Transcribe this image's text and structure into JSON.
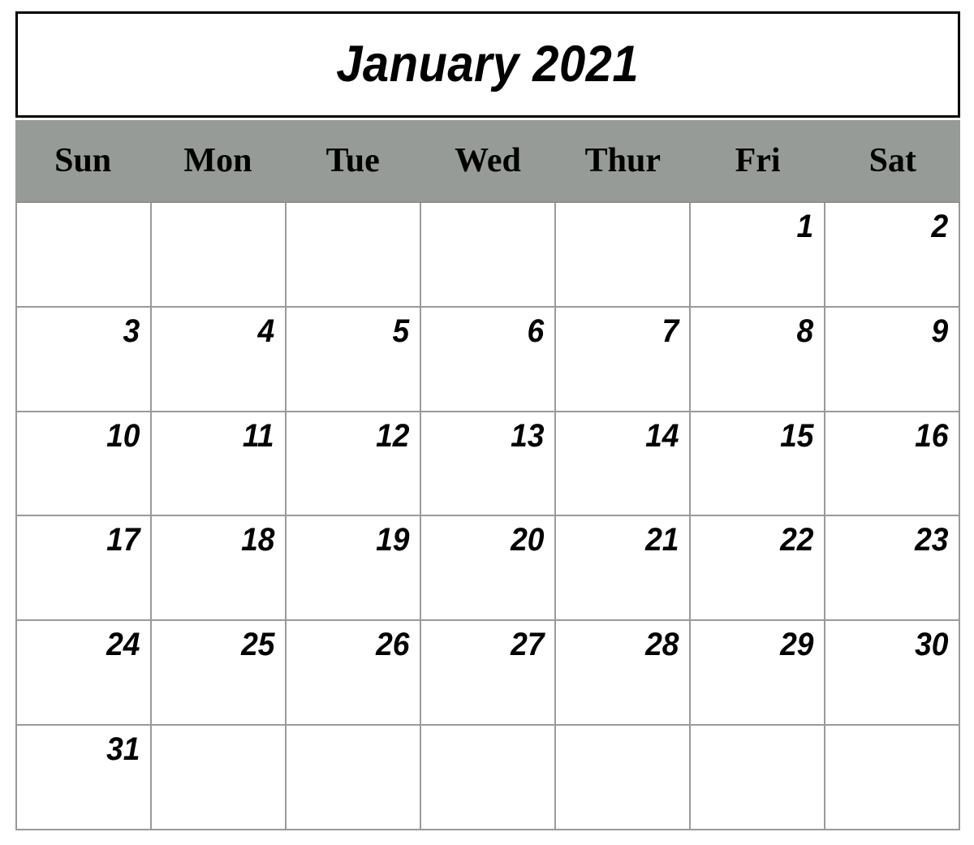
{
  "calendar": {
    "title": "January 2021",
    "month": "January",
    "year": "2021",
    "weekdays": [
      {
        "label": "Sun"
      },
      {
        "label": "Mon"
      },
      {
        "label": "Tue"
      },
      {
        "label": "Wed"
      },
      {
        "label": "Thur"
      },
      {
        "label": "Fri"
      },
      {
        "label": "Sat"
      }
    ],
    "weeks": [
      {
        "days": [
          "",
          "",
          "",
          "",
          "",
          "1",
          "2"
        ]
      },
      {
        "days": [
          "3",
          "4",
          "5",
          "6",
          "7",
          "8",
          "9"
        ]
      },
      {
        "days": [
          "10",
          "11",
          "12",
          "13",
          "14",
          "15",
          "16"
        ]
      },
      {
        "days": [
          "17",
          "18",
          "19",
          "20",
          "21",
          "22",
          "23"
        ]
      },
      {
        "days": [
          "24",
          "25",
          "26",
          "27",
          "28",
          "29",
          "30"
        ]
      },
      {
        "days": [
          "31",
          "",
          "",
          "",
          "",
          "",
          ""
        ]
      }
    ],
    "colors": {
      "header_background": "#969b97",
      "page_background": "#ffffff",
      "title_border": "#000000",
      "grid_line": "#9a9a9a",
      "text": "#000000"
    }
  }
}
